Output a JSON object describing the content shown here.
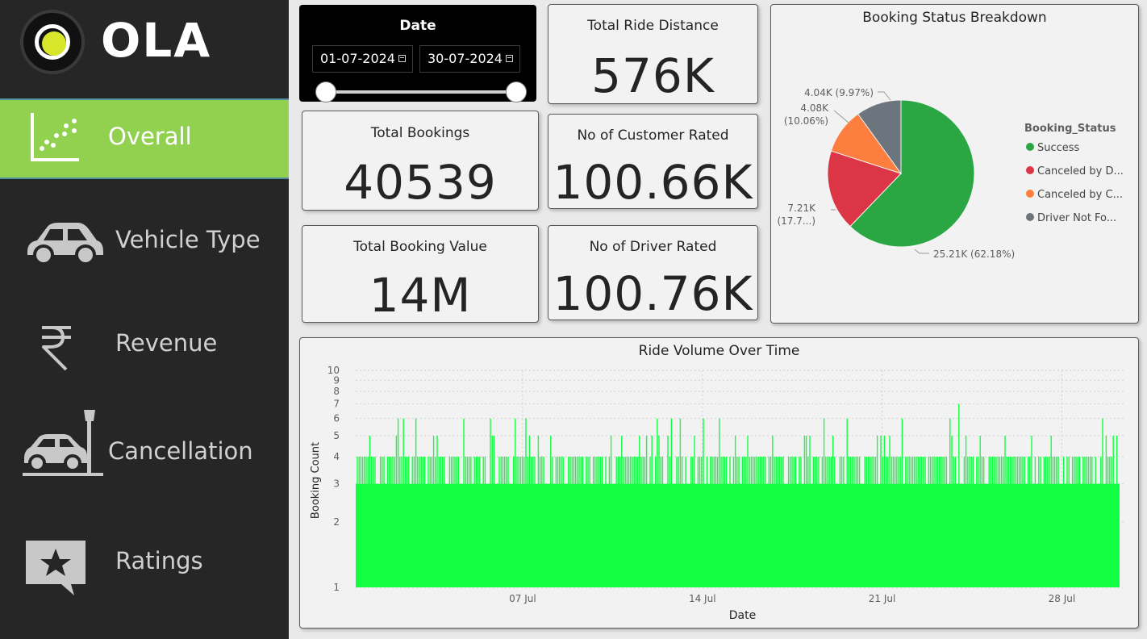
{
  "brand": {
    "logo_text": "OLA",
    "accent": "#92d050",
    "logo_dot": "#d7e52b"
  },
  "sidebar": {
    "items": [
      {
        "label": "Overall",
        "icon": "scatter-chart-icon",
        "active": true
      },
      {
        "label": "Vehicle Type",
        "icon": "car-icon",
        "active": false
      },
      {
        "label": "Revenue",
        "icon": "rupee-icon",
        "active": false
      },
      {
        "label": "Cancellation",
        "icon": "car-crash-icon",
        "active": false
      },
      {
        "label": "Ratings",
        "icon": "star-speech-icon",
        "active": false
      }
    ]
  },
  "date_slicer": {
    "title": "Date",
    "start": "01-07-2024",
    "end": "30-07-2024"
  },
  "kpis": {
    "total_ride_distance": {
      "title": "Total Ride Distance",
      "value": "576K"
    },
    "total_bookings": {
      "title": "Total Bookings",
      "value": "40539"
    },
    "customer_rated": {
      "title": "No of Customer Rated",
      "value": "100.66K"
    },
    "total_booking_value": {
      "title": "Total Booking Value",
      "value": "14M"
    },
    "driver_rated": {
      "title": "No of Driver Rated",
      "value": "100.76K"
    }
  },
  "chart_data": [
    {
      "type": "pie",
      "title": "Booking Status Breakdown",
      "legend_title": "Booking_Status",
      "legend_position": "right",
      "slices": [
        {
          "name": "Success",
          "legend_label": "Success",
          "value": 25.21,
          "percent": 62.18,
          "label_line1": "25.21K (62.18%)",
          "label_line2": "",
          "color": "#2aa743"
        },
        {
          "name": "Canceled by Driver",
          "legend_label": "Canceled by D...",
          "value": 7.21,
          "percent": 17.79,
          "label_line1": "7.21K",
          "label_line2": "(17.7...)",
          "color": "#dc3545"
        },
        {
          "name": "Canceled by Customer",
          "legend_label": "Canceled by C...",
          "value": 4.08,
          "percent": 10.06,
          "label_line1": "4.08K",
          "label_line2": "(10.06%)",
          "color": "#fd7e3e"
        },
        {
          "name": "Driver Not Found",
          "legend_label": "Driver Not Fo...",
          "value": 4.04,
          "percent": 9.97,
          "label_line1": "4.04K (9.97%)",
          "label_line2": "",
          "color": "#6c757d"
        }
      ]
    },
    {
      "type": "bar",
      "title": "Ride Volume Over Time",
      "xlabel": "Date",
      "ylabel": "Booking Count",
      "y_scale": "log",
      "ylim": [
        1,
        10
      ],
      "y_ticks": [
        "1",
        "2",
        "3",
        "4",
        "5",
        "6",
        "7",
        "8",
        "9",
        "10"
      ],
      "x_ticks": [
        "07 Jul",
        "14 Jul",
        "21 Jul",
        "28 Jul"
      ],
      "x_range": [
        "01 Jul",
        "30 Jul"
      ],
      "grid": true,
      "color": "#12ff41",
      "baseline_value": 3,
      "spike_values": [
        5,
        4,
        6,
        7
      ],
      "note": ""
    }
  ]
}
